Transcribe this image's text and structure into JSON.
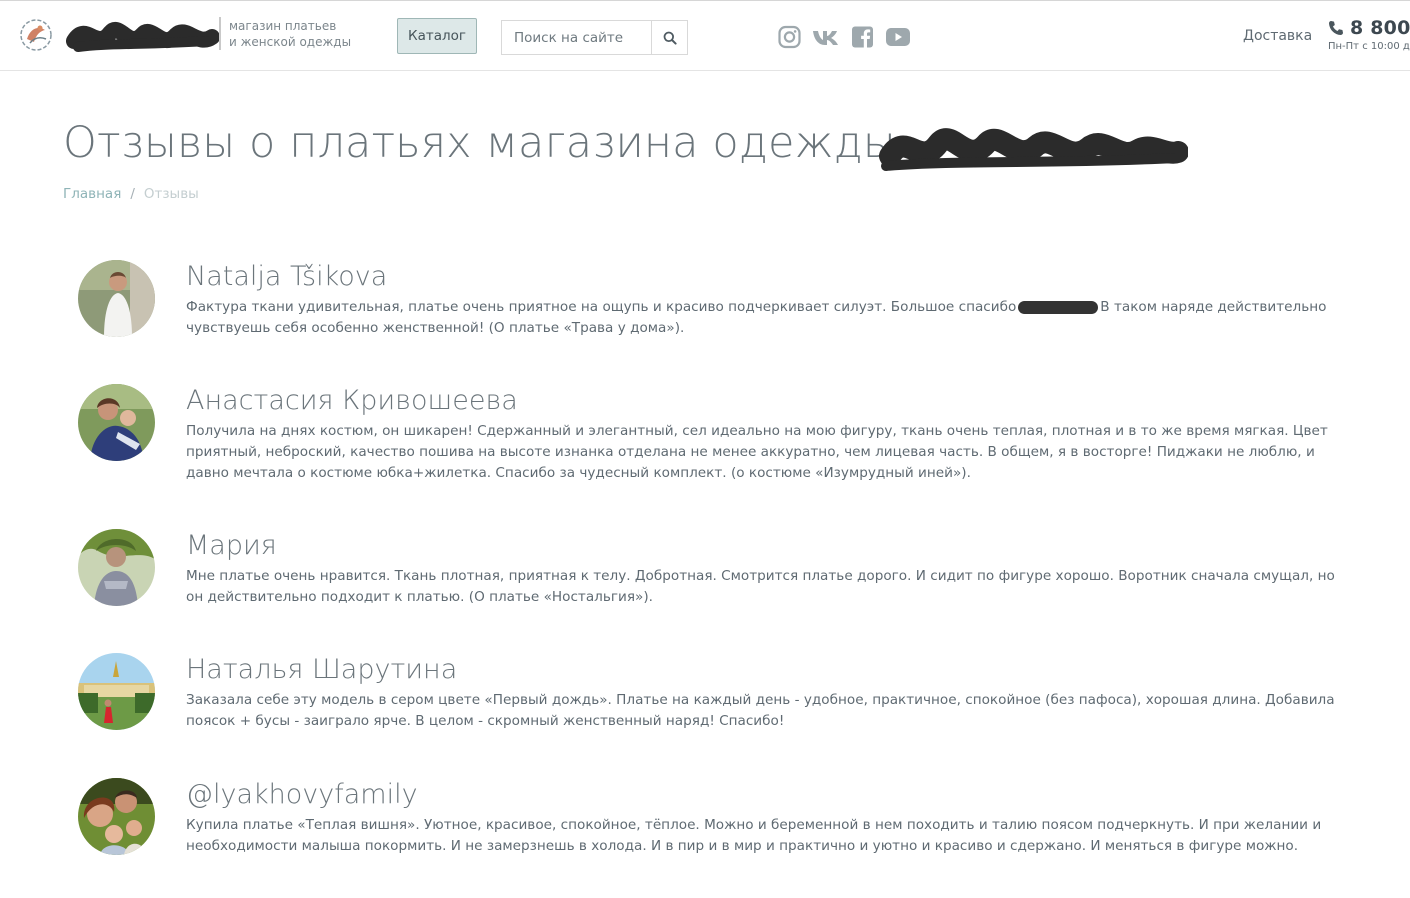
{
  "header": {
    "tagline_line1": "магазин платьев",
    "tagline_line2": "и женской одежды",
    "catalog_label": "Каталог",
    "search_placeholder": "Поиск на сайте",
    "social": [
      "instagram-icon",
      "vk-icon",
      "facebook-icon",
      "youtube-icon"
    ],
    "delivery_label": "Доставка",
    "phone_number": "8 800",
    "phone_hours": "Пн-Пт с 10:00 д"
  },
  "page": {
    "title": "Отзывы о платьях магазина одежды",
    "breadcrumb": {
      "home": "Главная",
      "separator": "/",
      "current": "Отзывы"
    }
  },
  "reviews": [
    {
      "name": "Natalja Tšikova",
      "text_before": "Фактура ткани удивительная, платье очень приятное на ощупь и красиво подчеркивает силуэт. Большое спасибо",
      "text_after": "В таком наряде действительно чувствуешь себя особенно женственной! (О платье «Трава у дома»)."
    },
    {
      "name": "Анастасия Кривошеева",
      "text": "Получила на днях костюм, он шикарен! Сдержанный и элегантный, сел идеально на мою фигуру, ткань очень теплая, плотная и в то же время мягкая. Цвет приятный, неброский, качество пошива на высоте изнанка отделана не менее аккуратно, чем лицевая часть. В общем, я в восторге! Пиджаки не люблю, и давно мечтала о костюме юбка+жилетка. Спасибо за чудесный комплект. (о костюме «Изумрудный иней»)."
    },
    {
      "name": "Мария",
      "text": "Мне платье очень нравится. Ткань плотная, приятная к телу. Добротная. Смотрится платье дорого. И сидит по фигуре хорошо. Воротник сначала смущал, но он действительно подходит к платью. (О платье «Ностальгия»)."
    },
    {
      "name": "Наталья Шарутина",
      "text": "Заказала себе эту модель в сером цвете «Первый дождь». Платье на каждый день - удобное, практичное, спокойное (без пафоса), хорошая длина. Добавила поясок + бусы - заиграло ярче. В целом - скромный женственный наряд! Спасибо!"
    },
    {
      "name": "@lyakhovyfamily",
      "text": "Купила платье «Теплая вишня». Уютное, красивое, спокойное, тёплое. Можно и беременной в нем походить и талию поясом подчеркнуть. И при желании и необходимости малыша покормить. И не замерзнешь в холода. И в пир и в мир и практично и уютно и красиво и сдержано. И меняться в фигуре можно."
    }
  ],
  "colors": {
    "accent_button_bg": "#dde8e8",
    "breadcrumb_link": "#8fb4b7",
    "text": "#5f6a72",
    "heading": "#6b757b"
  }
}
